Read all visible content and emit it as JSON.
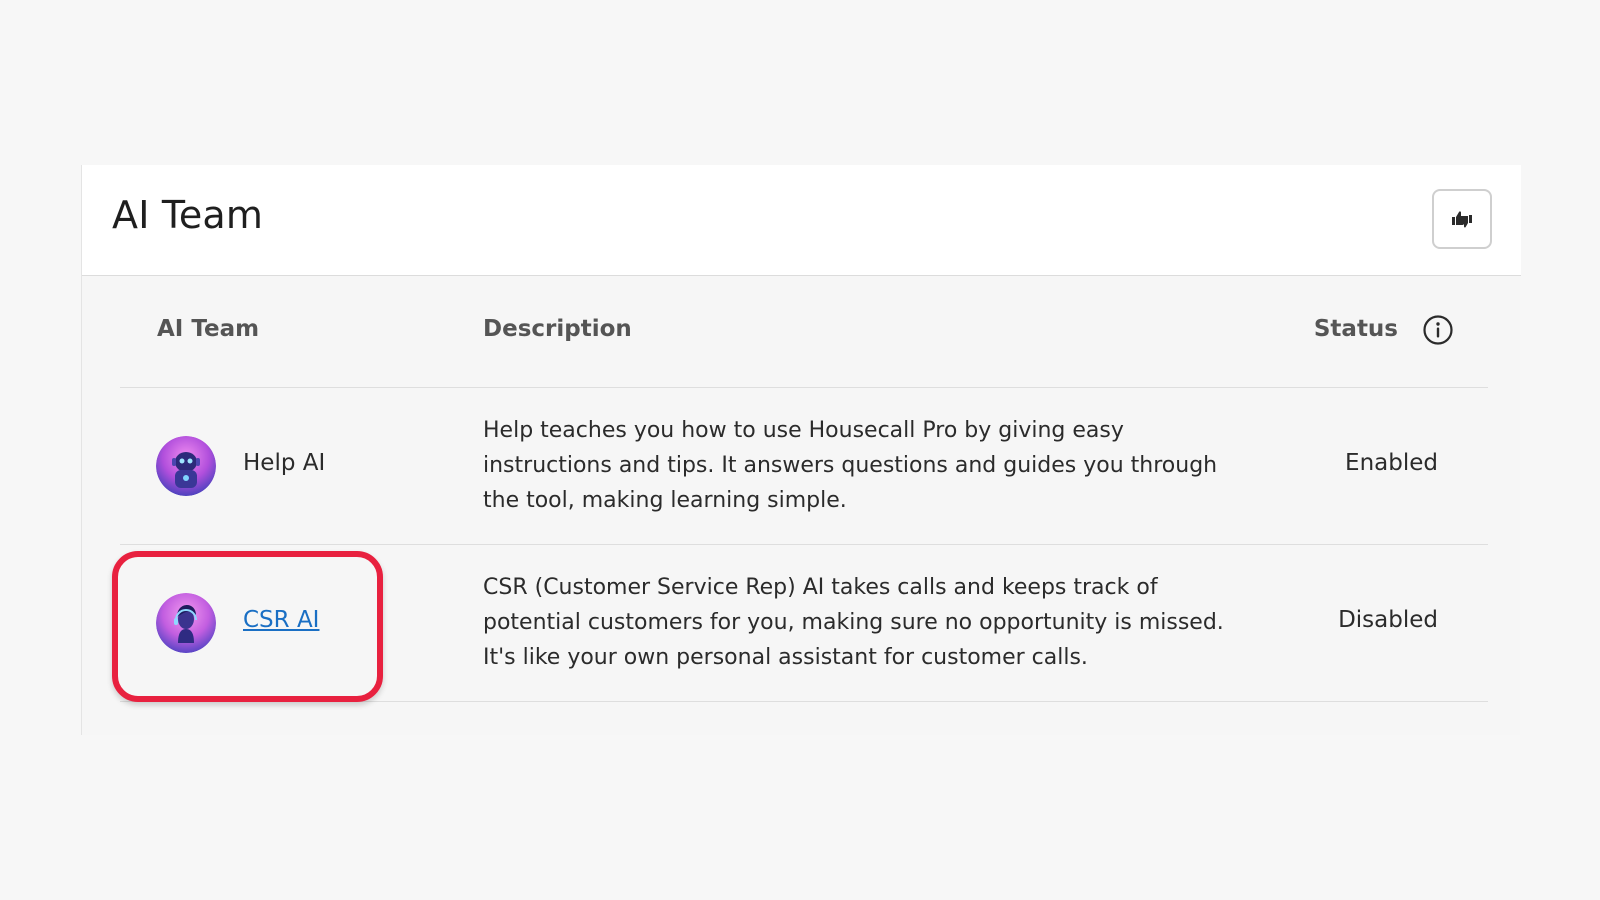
{
  "header": {
    "title": "AI Team",
    "feedback_icon": "thumbs-up-down-icon"
  },
  "table": {
    "columns": {
      "team": "AI Team",
      "description": "Description",
      "status": "Status"
    },
    "status_info_icon": "info-icon",
    "rows": [
      {
        "name": "Help AI",
        "avatar_icon": "robot-avatar",
        "description": "Help teaches you how to use Housecall Pro by giving easy instructions and tips. It answers questions and guides you through the tool, making learning simple.",
        "status": "Enabled",
        "is_link": false
      },
      {
        "name": "CSR AI",
        "avatar_icon": "headset-person-avatar",
        "description": "CSR (Customer Service Rep) AI takes calls and keeps track of potential customers for you, making sure no opportunity is missed. It's like your own personal assistant for customer calls.",
        "status": "Disabled",
        "is_link": true
      }
    ]
  },
  "colors": {
    "link": "#1a6fc4",
    "highlight": "#e8213f",
    "avatar_gradient_start": "#e060e8",
    "avatar_gradient_end": "#3a3fb8"
  }
}
